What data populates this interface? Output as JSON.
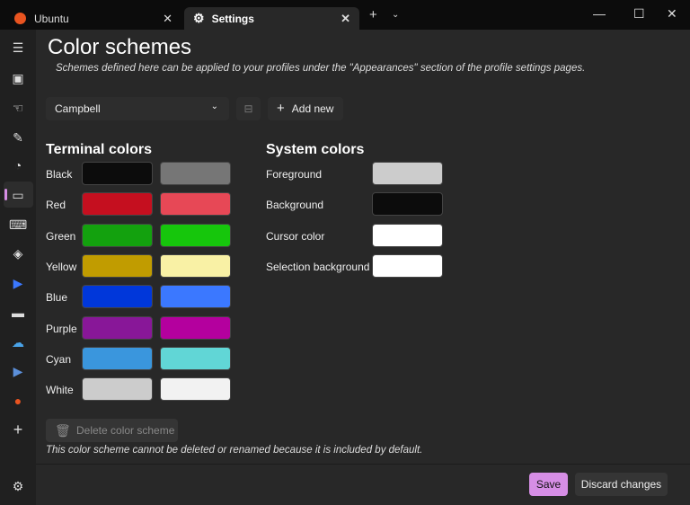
{
  "tabs": [
    {
      "label": "Ubuntu",
      "icon": "ubuntu-icon"
    },
    {
      "label": "Settings",
      "icon": "gear-icon"
    }
  ],
  "page": {
    "title": "Color schemes",
    "subtitle": "Schemes defined here can be applied to your profiles under the \"Appearances\" section of the profile settings pages."
  },
  "scheme_dropdown": {
    "value": "Campbell"
  },
  "add_new_label": "Add new",
  "terminal": {
    "title": "Terminal colors",
    "rows": [
      {
        "label": "Black",
        "normal": "#0C0C0C",
        "bright": "#767676"
      },
      {
        "label": "Red",
        "normal": "#C50F1F",
        "bright": "#E74856"
      },
      {
        "label": "Green",
        "normal": "#13A10E",
        "bright": "#16C60C"
      },
      {
        "label": "Yellow",
        "normal": "#C19C00",
        "bright": "#F9F1A5"
      },
      {
        "label": "Blue",
        "normal": "#0037DA",
        "bright": "#3B78FF"
      },
      {
        "label": "Purple",
        "normal": "#881798",
        "bright": "#B4009E"
      },
      {
        "label": "Cyan",
        "normal": "#3A96DD",
        "bright": "#61D6D6"
      },
      {
        "label": "White",
        "normal": "#CCCCCC",
        "bright": "#F2F2F2"
      }
    ]
  },
  "system": {
    "title": "System colors",
    "rows": [
      {
        "label": "Foreground",
        "color": "#CCCCCC"
      },
      {
        "label": "Background",
        "color": "#0C0C0C"
      },
      {
        "label": "Cursor color",
        "color": "#FFFFFF"
      },
      {
        "label": "Selection background",
        "color": "#FFFFFF"
      }
    ]
  },
  "delete_label": "Delete color scheme",
  "delete_note": "This color scheme cannot be deleted or renamed because it is included by default.",
  "footer": {
    "save": "Save",
    "discard": "Discard changes"
  },
  "accent": "#D68EE5"
}
